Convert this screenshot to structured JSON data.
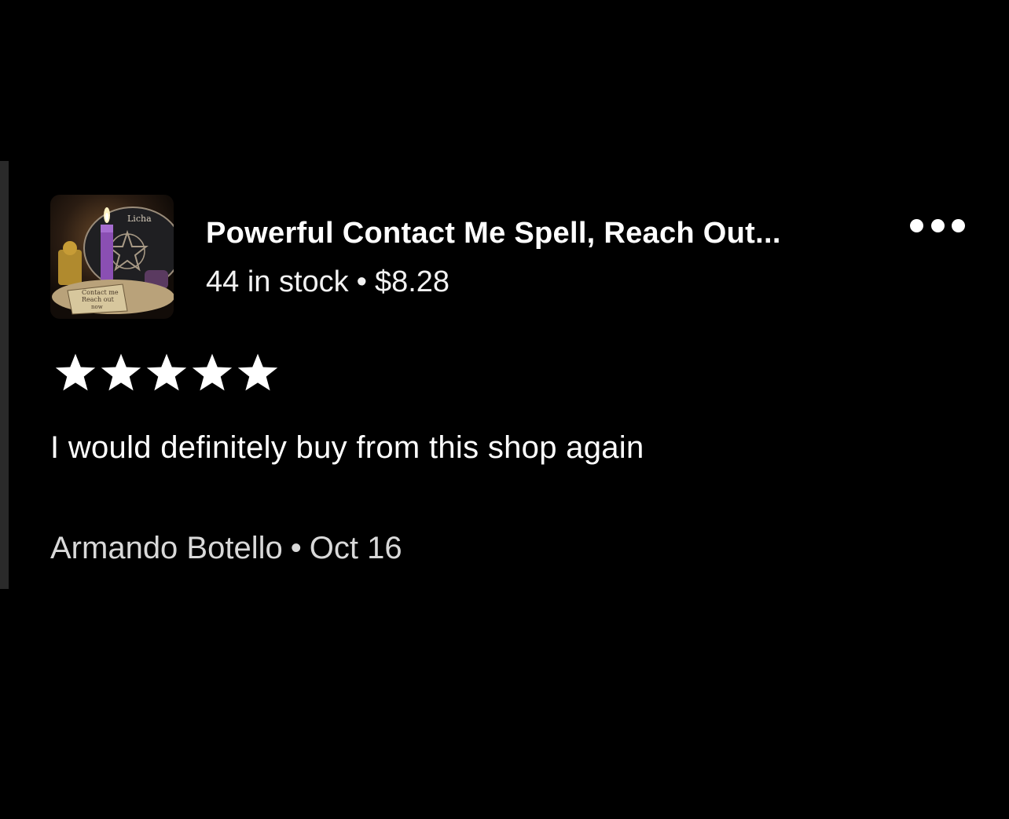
{
  "listing": {
    "title": "Powerful Contact Me Spell, Reach Out...",
    "stock": "44 in stock",
    "separator": "•",
    "price": "$8.28",
    "thumbnail_text": {
      "top": "Licha",
      "note_line1": "Contact me",
      "note_line2": "Reach out",
      "note_line3": "now"
    }
  },
  "review": {
    "rating": 5,
    "rating_max": 5,
    "text": "I would definitely buy from this shop again",
    "author": "Armando Botello",
    "separator": "•",
    "date": "Oct 16"
  },
  "icons": {
    "more": "more-horizontal-icon",
    "star": "star-filled-icon"
  },
  "colors": {
    "background": "#000000",
    "text": "#ffffff",
    "meta_text": "#d9d9d9",
    "star": "#ffffff"
  }
}
